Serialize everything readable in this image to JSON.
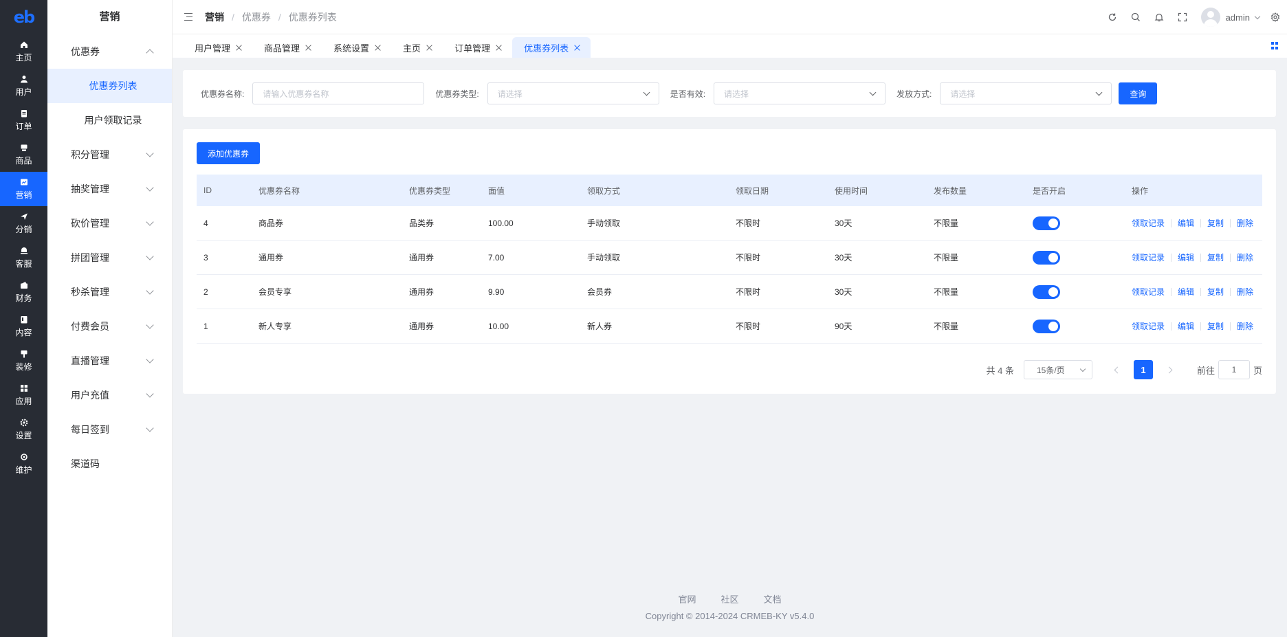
{
  "rail": {
    "logo": "eb",
    "items": [
      {
        "label": "主页",
        "icon": "home-icon"
      },
      {
        "label": "用户",
        "icon": "user-icon"
      },
      {
        "label": "订单",
        "icon": "order-icon"
      },
      {
        "label": "商品",
        "icon": "product-icon"
      },
      {
        "label": "营销",
        "icon": "marketing-icon"
      },
      {
        "label": "分销",
        "icon": "distribution-icon"
      },
      {
        "label": "客服",
        "icon": "service-icon"
      },
      {
        "label": "财务",
        "icon": "finance-icon"
      },
      {
        "label": "内容",
        "icon": "content-icon"
      },
      {
        "label": "装修",
        "icon": "decorate-icon"
      },
      {
        "label": "应用",
        "icon": "apps-icon"
      },
      {
        "label": "设置",
        "icon": "settings-icon"
      },
      {
        "label": "维护",
        "icon": "maintenance-icon"
      }
    ]
  },
  "sidebar": {
    "title": "营销",
    "coupon": "优惠券",
    "coupon_list": "优惠券列表",
    "coupon_records": "用户领取记录",
    "groups": [
      "积分管理",
      "抽奖管理",
      "砍价管理",
      "拼团管理",
      "秒杀管理",
      "付费会员",
      "直播管理",
      "用户充值",
      "每日签到"
    ],
    "channel_code": "渠道码"
  },
  "header": {
    "breadcrumb": [
      "营销",
      "优惠券",
      "优惠券列表"
    ],
    "separator": "/",
    "username": "admin"
  },
  "tabs": [
    "用户管理",
    "商品管理",
    "系统设置",
    "主页",
    "订单管理",
    "优惠券列表"
  ],
  "filter": {
    "name_label": "优惠券名称:",
    "name_placeholder": "请输入优惠券名称",
    "type_label": "优惠券类型:",
    "type_placeholder": "请选择",
    "valid_label": "是否有效:",
    "valid_placeholder": "请选择",
    "method_label": "发放方式:",
    "method_placeholder": "请选择",
    "query_button": "查询"
  },
  "add_button": "添加优惠券",
  "table": {
    "headers": [
      "ID",
      "优惠券名称",
      "优惠券类型",
      "面值",
      "领取方式",
      "领取日期",
      "使用时间",
      "发布数量",
      "是否开启",
      "操作"
    ],
    "rows": [
      {
        "id": "4",
        "name": "商品券",
        "type": "品类券",
        "value": "100.00",
        "method": "手动领取",
        "date": "不限时",
        "use": "30天",
        "count": "不限量",
        "enabled": true
      },
      {
        "id": "3",
        "name": "通用券",
        "type": "通用券",
        "value": "7.00",
        "method": "手动领取",
        "date": "不限时",
        "use": "30天",
        "count": "不限量",
        "enabled": true
      },
      {
        "id": "2",
        "name": "会员专享",
        "type": "通用券",
        "value": "9.90",
        "method": "会员券",
        "date": "不限时",
        "use": "30天",
        "count": "不限量",
        "enabled": true
      },
      {
        "id": "1",
        "name": "新人专享",
        "type": "通用券",
        "value": "10.00",
        "method": "新人券",
        "date": "不限时",
        "use": "90天",
        "count": "不限量",
        "enabled": true
      }
    ],
    "ops": [
      "领取记录",
      "编辑",
      "复制",
      "删除"
    ]
  },
  "pagination": {
    "total": "共 4 条",
    "page_size": "15条/页",
    "current": "1",
    "goto_label": "前往",
    "goto_value": "1",
    "page_suffix": "页"
  },
  "footer": {
    "links": [
      "官网",
      "社区",
      "文档"
    ],
    "copyright": "Copyright © 2014-2024 CRMEB-KY v5.4.0"
  },
  "colors": {
    "accent": "#1766ff",
    "rail_bg": "#282c34"
  }
}
